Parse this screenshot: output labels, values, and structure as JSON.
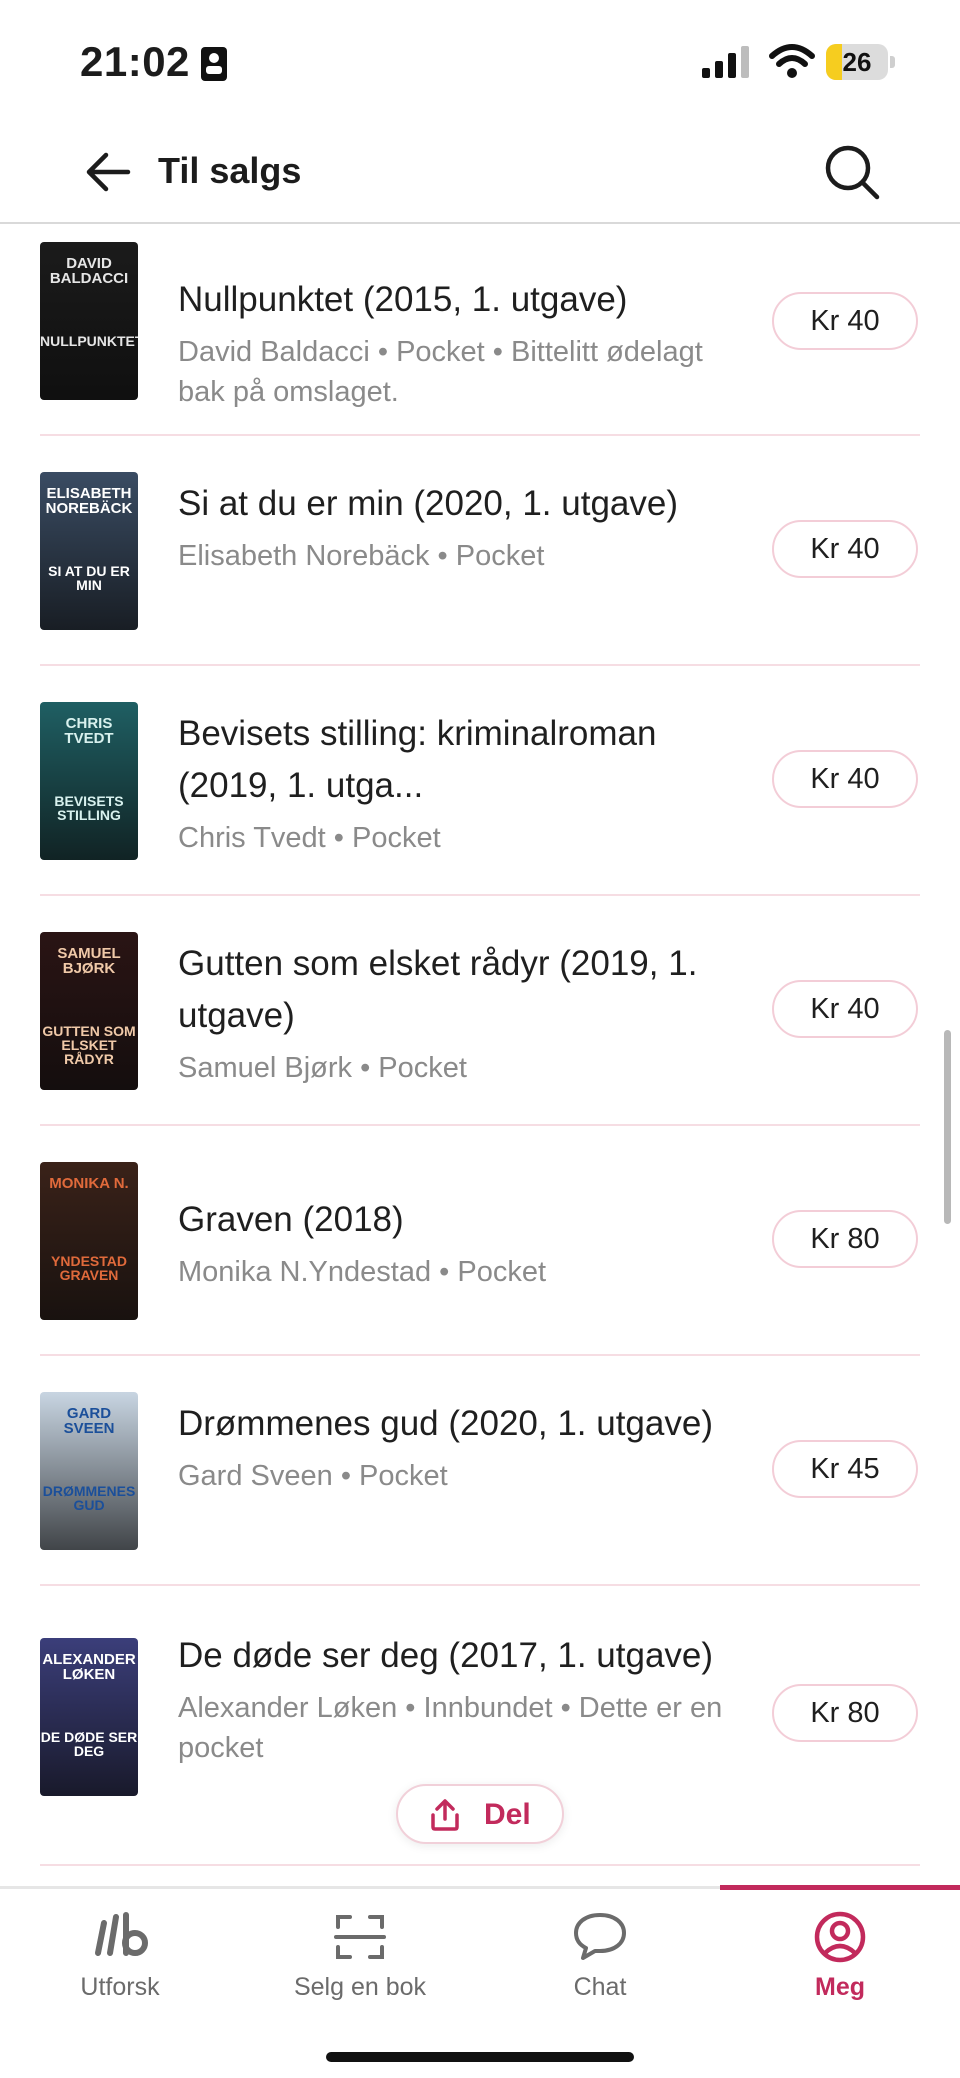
{
  "status_bar": {
    "time": "21:02",
    "battery": "26",
    "battery_level": 0.26
  },
  "header": {
    "title": "Til salgs"
  },
  "listings": [
    {
      "title": "Nullpunktet (2015, 1. utgave)",
      "meta": "David Baldacci • Pocket • Bittelitt ødelagt bak på omslaget.",
      "price": "Kr 40",
      "cover": {
        "author": "DAVID BALDACCI",
        "title": "NULLPUNKTET",
        "bg": "#1b1b1b",
        "accent": "#e6e6e6"
      }
    },
    {
      "title": "Si at du er min (2020, 1. utgave)",
      "meta": "Elisabeth Norebäck • Pocket",
      "price": "Kr 40",
      "cover": {
        "author": "ELISABETH NOREBÄCK",
        "title": "SI AT DU ER MIN",
        "bg": "#3a4c63",
        "accent": "#ffffff"
      }
    },
    {
      "title": "Bevisets stilling: kriminalroman (2019, 1. utga...",
      "meta": "Chris Tvedt • Pocket",
      "price": "Kr 40",
      "cover": {
        "author": "CHRIS TVEDT",
        "title": "BEVISETS STILLING",
        "bg": "#1f5f63",
        "accent": "#d8f1ee"
      }
    },
    {
      "title": "Gutten som elsket rådyr (2019, 1. utgave)",
      "meta": "Samuel Bjørk • Pocket",
      "price": "Kr 40",
      "cover": {
        "author": "SAMUEL BJØRK",
        "title": "GUTTEN SOM ELSKET RÅDYR",
        "bg": "#2a1414",
        "accent": "#f0c9a8"
      }
    },
    {
      "title": "Graven (2018)",
      "meta": "Monika N.Yndestad • Pocket",
      "price": "Kr 80",
      "cover": {
        "author": "MONIKA N.",
        "title": "YNDESTAD GRAVEN",
        "bg": "#3a2219",
        "accent": "#e06a3b"
      }
    },
    {
      "title": "Drømmenes gud (2020, 1. utgave)",
      "meta": "Gard Sveen • Pocket",
      "price": "Kr 45",
      "cover": {
        "author": "GARD SVEEN",
        "title": "DRØMMENES GUD",
        "bg": "#c8d5e2",
        "accent": "#1b4f9a"
      }
    },
    {
      "title": "De døde ser deg (2017, 1. utgave)",
      "meta": "Alexander Løken • Innbundet • Dette er en pocket",
      "price": "Kr 80",
      "cover": {
        "author": "ALEXANDER LØKEN",
        "title": "DE DØDE SER DEG",
        "bg": "#3b3e7a",
        "accent": "#ffffff"
      }
    }
  ],
  "share": {
    "label": "Del"
  },
  "tabs": [
    {
      "label": "Utforsk",
      "icon": "library-logo-icon"
    },
    {
      "label": "Selg en bok",
      "icon": "scan-frame-icon"
    },
    {
      "label": "Chat",
      "icon": "chat-bubble-icon"
    },
    {
      "label": "Meg",
      "icon": "profile-icon",
      "active": true
    }
  ],
  "colors": {
    "accent": "#c22a5c",
    "divider": "#f6dde3",
    "price_border": "#f3cdd7",
    "meta_text": "#8a8a8a"
  }
}
